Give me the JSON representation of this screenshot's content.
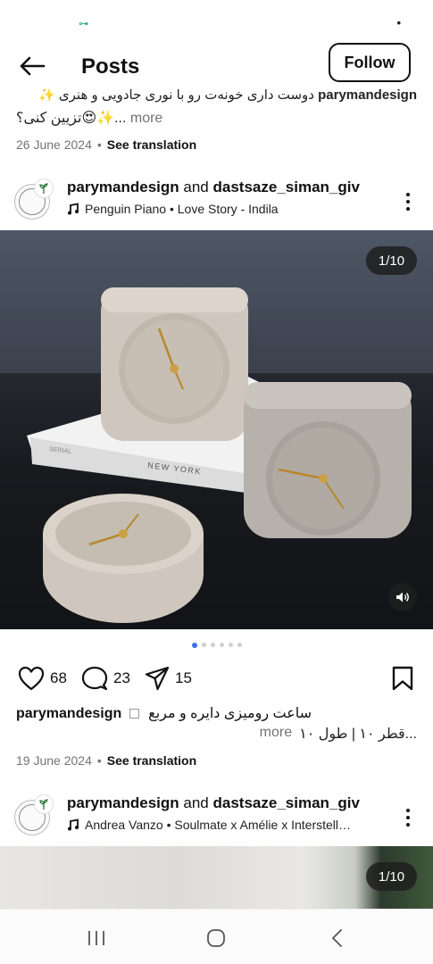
{
  "status": {
    "left_glyph": "⊶",
    "right_glyph": "•"
  },
  "header": {
    "title": "Posts",
    "follow_label": "Follow"
  },
  "prev_post": {
    "username": "parymandesign",
    "caption_line1": "دوست داری خونه‌ت رو با نوری جادویی و هنری ✨",
    "caption_line2": "تزیین کنی؟😍✨...",
    "more_label": "more",
    "date": "26 June 2024",
    "translate_label": "See translation"
  },
  "post": {
    "username": "parymandesign",
    "connector": "and",
    "collaborator": "dastsaze_siman_giv",
    "music": "Penguin Piano • Love Story - Indila",
    "counter": "1/10",
    "image_alt": "Three concrete table clocks on a white book",
    "book_text": "NEW YORK",
    "book_spine_text": "SERIAL",
    "likes": "68",
    "comments": "23",
    "shares": "15",
    "carousel_total": 6,
    "carousel_active": 0,
    "caption_user": "parymandesign",
    "caption_line1": "ساعت رومیزی دایره و مربع",
    "caption_line2": "قطر ۱۰ | طول ۱۰...",
    "more_label": "more",
    "date": "19 June 2024",
    "translate_label": "See translation"
  },
  "post2": {
    "username": "parymandesign",
    "connector": "and",
    "collaborator": "dastsaze_siman_giv",
    "music": "Andrea Vanzo • Soulmate x Amélie x Interstell…",
    "counter": "1/10"
  },
  "icons": {
    "back": "arrow-left-icon",
    "more": "more-vertical-icon",
    "music": "music-note-icon",
    "like": "heart-icon",
    "comment": "comment-icon",
    "share": "send-icon",
    "save": "bookmark-icon",
    "sound": "speaker-icon",
    "nav_recents": "recents-icon",
    "nav_home": "home-icon",
    "nav_back": "chevron-left-icon"
  },
  "colors": {
    "text": "#111111",
    "muted": "#737373",
    "active_dot": "#3b6ff0"
  }
}
